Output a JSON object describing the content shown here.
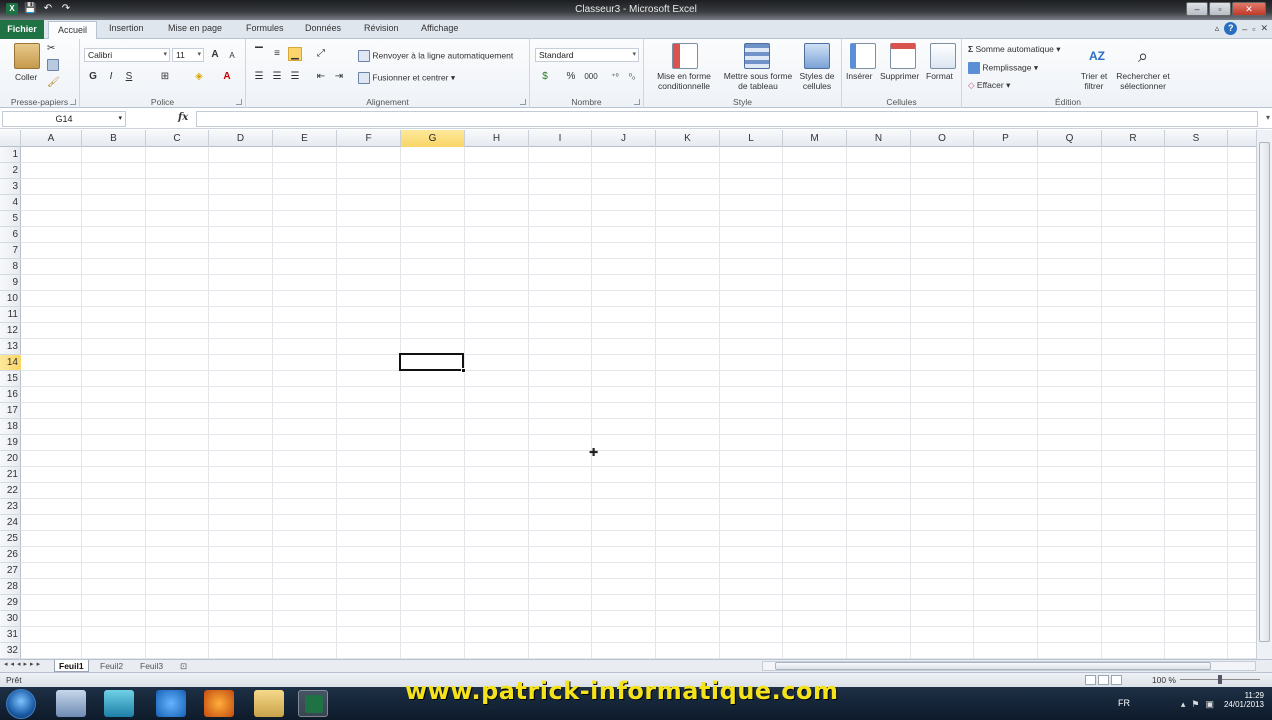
{
  "window": {
    "title": "Classeur3 - Microsoft Excel",
    "minimize": "–",
    "restore": "▫",
    "close": "✕"
  },
  "qat": {
    "save": "💾",
    "undo": "↶",
    "redo": "↷"
  },
  "tabs": {
    "file": "Fichier",
    "items": [
      "Accueil",
      "Insertion",
      "Mise en page",
      "Formules",
      "Données",
      "Révision",
      "Affichage"
    ]
  },
  "ribbon": {
    "clipboard": {
      "label": "Presse-papiers",
      "paste": "Coller"
    },
    "font": {
      "label": "Police",
      "family": "Calibri",
      "size": "11",
      "bold": "G",
      "italic": "I",
      "underline": "S"
    },
    "alignment": {
      "label": "Alignement",
      "wrap": "Renvoyer à la ligne automatiquement",
      "merge": "Fusionner et centrer"
    },
    "number": {
      "label": "Nombre",
      "format": "Standard",
      "percent": "%",
      "thousands": "000"
    },
    "style": {
      "label": "Style",
      "cond": "Mise en forme conditionnelle",
      "table": "Mettre sous forme de tableau",
      "cellstyles": "Styles de cellules"
    },
    "cells": {
      "label": "Cellules",
      "insert": "Insérer",
      "delete": "Supprimer",
      "format": "Format"
    },
    "editing": {
      "label": "Édition",
      "autosum": "Somme automatique",
      "fill": "Remplissage",
      "clear": "Effacer",
      "sort": "Trier et filtrer",
      "find": "Rechercher et sélectionner"
    }
  },
  "formula_bar": {
    "name_box": "G14",
    "fx": "fx",
    "value": ""
  },
  "grid": {
    "columns": [
      "A",
      "B",
      "C",
      "D",
      "E",
      "F",
      "G",
      "H",
      "I",
      "J",
      "K",
      "L",
      "M",
      "N",
      "O",
      "P",
      "Q",
      "R",
      "S"
    ],
    "rows": [
      "1",
      "2",
      "3",
      "4",
      "5",
      "6",
      "7",
      "8",
      "9",
      "10",
      "11",
      "12",
      "13",
      "14",
      "15",
      "16",
      "17",
      "18",
      "19",
      "20",
      "21",
      "22",
      "23",
      "24",
      "25",
      "26",
      "27",
      "28",
      "29",
      "30",
      "31",
      "32"
    ],
    "selected_col": "G",
    "selected_row": "14"
  },
  "sheets": [
    "Feuil1",
    "Feuil2",
    "Feuil3"
  ],
  "status": {
    "ready": "Prêt",
    "zoom": "100 %"
  },
  "taskbar": {
    "watermark": "www.patrick-informatique.com",
    "lang": "FR",
    "time": "11:29",
    "date": "24/01/2013"
  },
  "colors": {
    "file_tab": "#1f7244",
    "selection": "#f9d565",
    "watermark": "#f4e21c"
  }
}
